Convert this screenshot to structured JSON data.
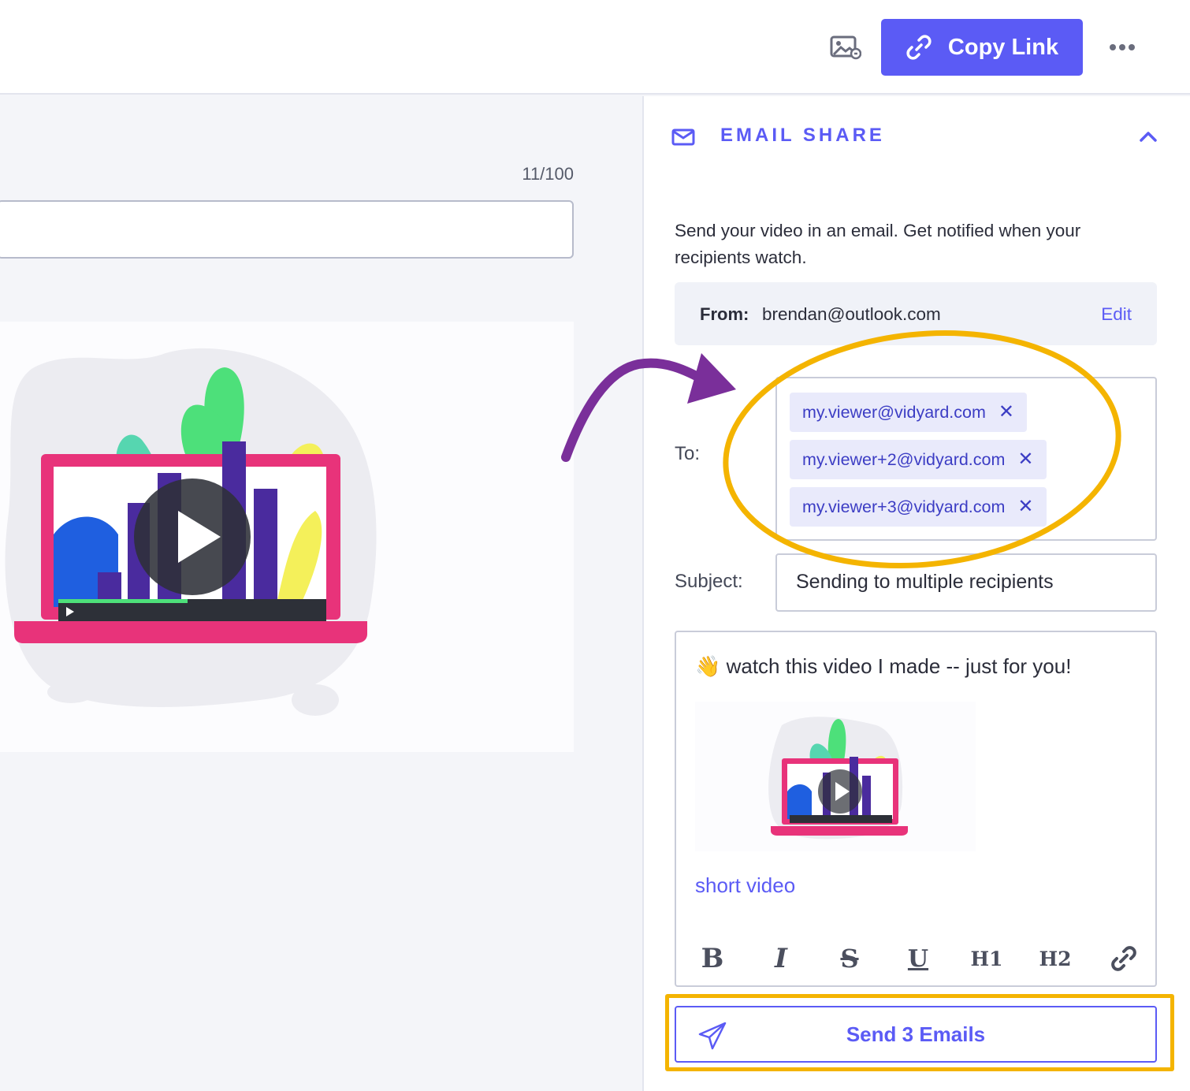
{
  "header": {
    "thumbnail_icon": "image-link-icon",
    "copy_link_label": "Copy Link",
    "copy_link_icon": "link-icon",
    "more_icon": "ellipsis-icon"
  },
  "editor_left": {
    "title_counter": "11/100",
    "title_value": ""
  },
  "email_share": {
    "section_title": "EMAIL SHARE",
    "section_icon": "mail-icon",
    "description": "Send your video in an email. Get notified when your recipients watch.",
    "from_label": "From:",
    "from_value": "brendan@outlook.com",
    "edit_label": "Edit",
    "to_label": "To:",
    "recipients": [
      "my.viewer@vidyard.com",
      "my.viewer+2@vidyard.com",
      "my.viewer+3@vidyard.com"
    ],
    "subject_label": "Subject:",
    "subject_value": "Sending to multiple recipients",
    "body_text": "👋 watch this video I made -- just for you!",
    "video_link": "short video",
    "toolbar": [
      "B",
      "I",
      "S",
      "U",
      "H1",
      "H2"
    ],
    "send_label": "Send 3 Emails",
    "send_icon": "paper-plane-icon"
  },
  "colors": {
    "accent": "#5b5bf5",
    "annotation_yellow": "#f4b400",
    "annotation_purple": "#7a2f9a"
  }
}
